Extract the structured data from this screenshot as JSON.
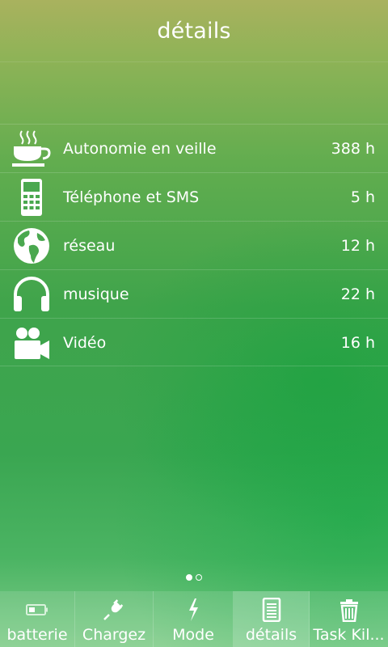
{
  "header": {
    "title": "détails"
  },
  "details": [
    {
      "icon": "coffee-cup-icon",
      "label": "Autonomie en veille",
      "value": "388 h"
    },
    {
      "icon": "phone-icon",
      "label": "Téléphone et SMS",
      "value": "5 h"
    },
    {
      "icon": "globe-icon",
      "label": "réseau",
      "value": "12 h"
    },
    {
      "icon": "headphones-icon",
      "label": "musique",
      "value": "22 h"
    },
    {
      "icon": "video-camera-icon",
      "label": "Vidéo",
      "value": "16 h"
    }
  ],
  "pager": {
    "pages": 2,
    "current": 1
  },
  "tabs": [
    {
      "icon": "battery-icon",
      "label": "batterie"
    },
    {
      "icon": "plug-icon",
      "label": "Chargez"
    },
    {
      "icon": "lightning-icon",
      "label": "Mode"
    },
    {
      "icon": "document-list-icon",
      "label": "détails",
      "active": true
    },
    {
      "icon": "trash-icon",
      "label": "Task Kil..."
    }
  ]
}
